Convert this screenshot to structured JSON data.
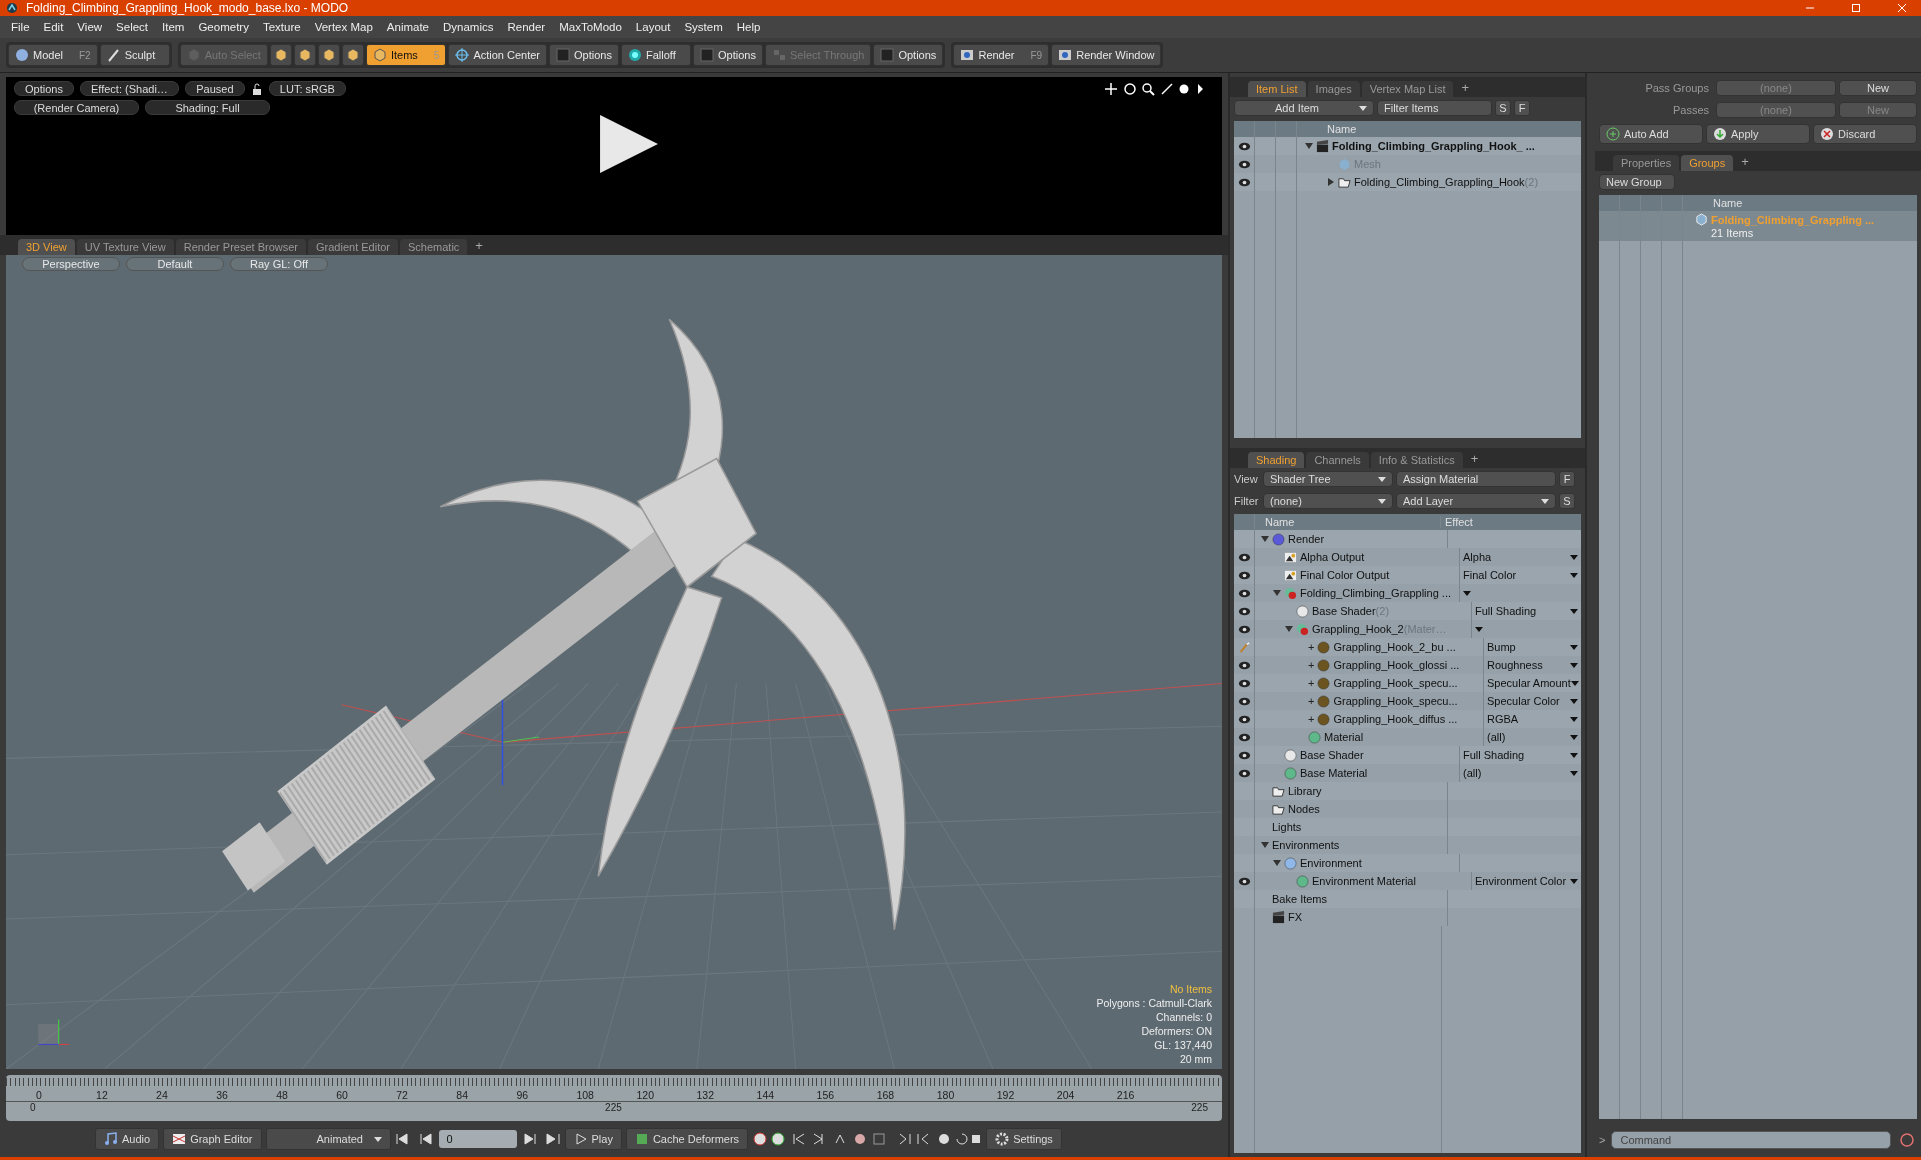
{
  "window": {
    "title": "Folding_Climbing_Grappling_Hook_modo_base.lxo - MODO"
  },
  "menu": [
    "File",
    "Edit",
    "View",
    "Select",
    "Item",
    "Geometry",
    "Texture",
    "Vertex Map",
    "Animate",
    "Dynamics",
    "Render",
    "MaxToModo",
    "Layout",
    "System",
    "Help"
  ],
  "toolbar": [
    [
      {
        "kind": "model",
        "label": "Model",
        "shortcut": "F2",
        "selected": false,
        "disabled": false
      },
      {
        "kind": "sculpt",
        "label": "Sculpt",
        "selected": false,
        "disabled": false
      }
    ],
    [
      {
        "kind": "autoselect",
        "label": "Auto Select",
        "selected": false,
        "disabled": true
      },
      {
        "kind": "vertices",
        "selected": false,
        "disabled": false
      },
      {
        "kind": "edges",
        "selected": false,
        "disabled": false
      },
      {
        "kind": "polygons",
        "selected": false,
        "disabled": false
      },
      {
        "kind": "materials",
        "selected": false,
        "disabled": false
      },
      {
        "kind": "items",
        "label": "Items",
        "shortcut": "5",
        "selected": true,
        "disabled": false
      },
      {
        "kind": "action",
        "label": "Action Center",
        "selected": false,
        "disabled": false
      },
      {
        "kind": "options",
        "label": "Options",
        "selected": false,
        "disabled": false
      },
      {
        "kind": "falloff",
        "label": "Falloff",
        "selected": false,
        "disabled": false
      },
      {
        "kind": "options",
        "label": "Options",
        "selected": false,
        "disabled": false
      },
      {
        "kind": "selthrough",
        "label": "Select Through",
        "selected": false,
        "disabled": true
      },
      {
        "kind": "options",
        "label": "Options",
        "selected": false,
        "disabled": false
      }
    ],
    [
      {
        "kind": "render",
        "label": "Render",
        "shortcut": "F9",
        "selected": false,
        "disabled": false
      },
      {
        "kind": "renderwin",
        "label": "Render Window",
        "selected": false,
        "disabled": false
      }
    ]
  ],
  "preview": {
    "row_1": [
      "Options",
      "Effect: (Shadi…",
      "Paused"
    ],
    "lut": "LUT: sRGB",
    "row_2": [
      "(Render Camera)",
      "Shading: Full"
    ]
  },
  "viewport": {
    "tabs": [
      {
        "label": "3D View",
        "selected": true
      },
      {
        "label": "UV Texture View",
        "selected": false
      },
      {
        "label": "Render Preset Browser",
        "selected": false
      },
      {
        "label": "Gradient Editor",
        "selected": false
      },
      {
        "label": "Schematic",
        "selected": false
      }
    ],
    "add_tab": "+",
    "buttons": [
      "Perspective",
      "Default",
      "Ray GL: Off"
    ],
    "info": [
      {
        "text": "No Items",
        "kind": "highlight"
      },
      {
        "text": "Polygons : Catmull-Clark",
        "kind": "plain"
      },
      {
        "text": "Channels: 0",
        "kind": "plain"
      },
      {
        "text": "Deformers: ON",
        "kind": "plain"
      },
      {
        "text": "GL: 137,440",
        "kind": "plain"
      },
      {
        "text": "20 mm",
        "kind": "plain"
      }
    ]
  },
  "timeline": {
    "ticks": [
      "0",
      "12",
      "24",
      "36",
      "48",
      "60",
      "72",
      "84",
      "96",
      "108",
      "120",
      "132",
      "144",
      "156",
      "168",
      "180",
      "192",
      "204",
      "216"
    ],
    "range_start": "0",
    "range_mid": "225",
    "range_end": "225"
  },
  "bottom_bar": {
    "audio": "Audio",
    "graph_editor": "Graph Editor",
    "mode": "Animated",
    "frame": "0",
    "play": "Play",
    "cache": "Cache Deformers",
    "settings": "Settings"
  },
  "item_list": {
    "tabs": [
      {
        "label": "Item List",
        "selected": true
      },
      {
        "label": "Images",
        "selected": false
      },
      {
        "label": "Vertex Map List",
        "selected": false
      }
    ],
    "add_tab": "+",
    "add_item": "Add Item",
    "filter": "Filter Items",
    "buttons": [
      "S",
      "F"
    ],
    "column": "Name",
    "rows": [
      {
        "name": "Folding_Climbing_Grappling_Hook_ ...",
        "kind": "scene",
        "visible": true,
        "disabled": false,
        "expanded": true,
        "children": [
          {
            "name": "Mesh",
            "kind": "mesh",
            "visible": true,
            "disabled": true
          },
          {
            "name": "Folding_Climbing_Grappling_Hook",
            "note": "(2)",
            "kind": "group",
            "visible": true,
            "disabled": false,
            "expanded": false
          }
        ]
      }
    ]
  },
  "shading": {
    "tabs": [
      {
        "label": "Shading",
        "selected": true
      },
      {
        "label": "Channels",
        "selected": false
      },
      {
        "label": "Info & Statistics",
        "selected": false
      }
    ],
    "add_tab": "+",
    "view_label": "View",
    "view": "Shader Tree",
    "assign": "Assign Material",
    "assign_key": "F",
    "filter_label": "Filter",
    "filter": "(none)",
    "add_layer": "Add Layer",
    "layer_key": "S",
    "columns": [
      "Name",
      "Effect"
    ],
    "rows": [
      {
        "name": "Render",
        "kind": "render",
        "visible": false,
        "brush": false,
        "expanded": true,
        "children": [
          {
            "name": "Alpha Output",
            "kind": "output",
            "visible": true,
            "brush": false,
            "effect": "Alpha",
            "dropdown": true
          },
          {
            "name": "Final Color Output",
            "kind": "output",
            "visible": true,
            "brush": false,
            "effect": "Final Color",
            "dropdown": true
          },
          {
            "name": "Folding_Climbing_Grappling ...",
            "kind": "mask",
            "visible": true,
            "brush": false,
            "dropdown": true,
            "expanded": true,
            "children": [
              {
                "name": "Base Shader",
                "note": "(2)",
                "kind": "shader",
                "visible": true,
                "brush": false,
                "effect": "Full Shading",
                "dropdown": true
              },
              {
                "name": "Grappling_Hook_2",
                "note": "(Mater…",
                "kind": "mask",
                "visible": true,
                "brush": false,
                "dropdown": true,
                "expanded": true,
                "children": [
                  {
                    "prefix": "+",
                    "name": "Grappling_Hook_2_bu ...",
                    "kind": "layer",
                    "visible": true,
                    "brush": true,
                    "effect": "Bump",
                    "dropdown": true
                  },
                  {
                    "prefix": "+",
                    "name": "Grappling_Hook_glossi ...",
                    "kind": "layer",
                    "visible": true,
                    "brush": false,
                    "effect": "Roughness",
                    "dropdown": true
                  },
                  {
                    "prefix": "+",
                    "name": "Grappling_Hook_specu...",
                    "kind": "layer",
                    "visible": true,
                    "brush": false,
                    "effect": "Specular Amount",
                    "dropdown": true
                  },
                  {
                    "prefix": "+",
                    "name": "Grappling_Hook_specu...",
                    "kind": "layer",
                    "visible": true,
                    "brush": false,
                    "effect": "Specular Color",
                    "dropdown": true
                  },
                  {
                    "prefix": "+",
                    "name": "Grappling_Hook_diffus ...",
                    "kind": "layer",
                    "visible": true,
                    "brush": false,
                    "effect": "RGBA",
                    "dropdown": true
                  },
                  {
                    "name": "Material",
                    "kind": "material",
                    "visible": true,
                    "brush": false,
                    "effect": "(all)",
                    "dropdown": true
                  }
                ]
              }
            ]
          },
          {
            "name": "Base Shader",
            "kind": "shader",
            "visible": true,
            "brush": false,
            "effect": "Full Shading",
            "dropdown": true
          },
          {
            "name": "Base Material",
            "kind": "material",
            "visible": true,
            "brush": false,
            "effect": "(all)",
            "dropdown": true
          }
        ]
      },
      {
        "name": "Library",
        "kind": "folder",
        "visible": false,
        "brush": false
      },
      {
        "name": "Nodes",
        "kind": "folder",
        "visible": false,
        "brush": false
      },
      {
        "name": "Lights",
        "kind": "plain",
        "visible": false,
        "brush": false
      },
      {
        "name": "Environments",
        "kind": "plain",
        "visible": false,
        "brush": false,
        "expanded": true,
        "children": [
          {
            "name": "Environment",
            "kind": "environment",
            "visible": false,
            "brush": false,
            "expanded": true,
            "children": [
              {
                "name": "Environment Material",
                "kind": "material",
                "visible": true,
                "brush": false,
                "effect": "Environment Color",
                "dropdown": true
              }
            ]
          }
        ]
      },
      {
        "name": "Bake Items",
        "kind": "plain",
        "visible": false,
        "brush": false
      },
      {
        "name": "FX",
        "kind": "fx",
        "visible": false,
        "brush": false
      }
    ]
  },
  "passes": {
    "pass_groups_label": "Pass Groups",
    "pass_groups": "(none)",
    "new_group": "New",
    "passes_label": "Passes",
    "passes": "(none)",
    "new_pass": "New",
    "auto_add": "Auto Add",
    "apply": "Apply",
    "discard": "Discard"
  },
  "groups": {
    "tabs": [
      {
        "label": "Properties",
        "selected": false
      },
      {
        "label": "Groups",
        "selected": true
      }
    ],
    "add_tab": "+",
    "new_group": "New Group",
    "column": "Name",
    "rows": [
      {
        "name": "Folding_Climbing_Grappling ...",
        "count": "21 Items"
      }
    ]
  },
  "command": {
    "prompt": ">",
    "placeholder": "Command"
  }
}
